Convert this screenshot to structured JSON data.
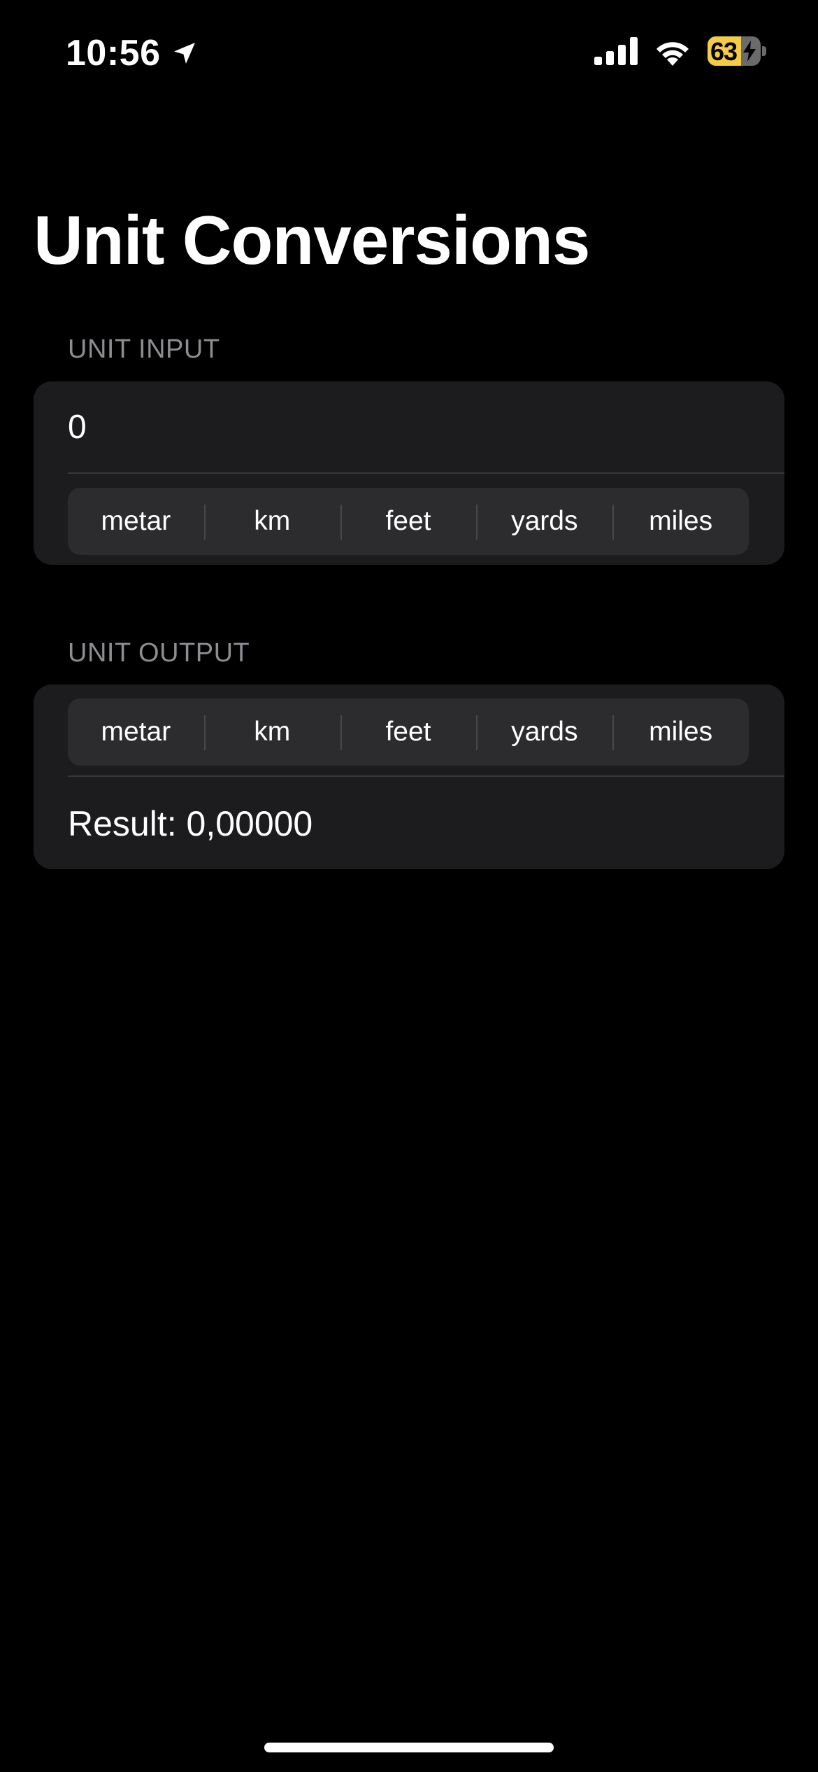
{
  "status_bar": {
    "time": "10:56",
    "battery_level": "63",
    "battery_fraction": 0.63,
    "location_icon": "location-arrow-icon",
    "signal_icon": "cellular-signal-icon",
    "wifi_icon": "wifi-icon",
    "battery_color": "#f5cc45"
  },
  "header": {
    "title": "Unit Conversions"
  },
  "input_section": {
    "label": "UNIT INPUT",
    "value": "0",
    "units": [
      "metar",
      "km",
      "feet",
      "yards",
      "miles"
    ]
  },
  "output_section": {
    "label": "UNIT OUTPUT",
    "units": [
      "metar",
      "km",
      "feet",
      "yards",
      "miles"
    ],
    "result": "Result: 0,00000"
  }
}
